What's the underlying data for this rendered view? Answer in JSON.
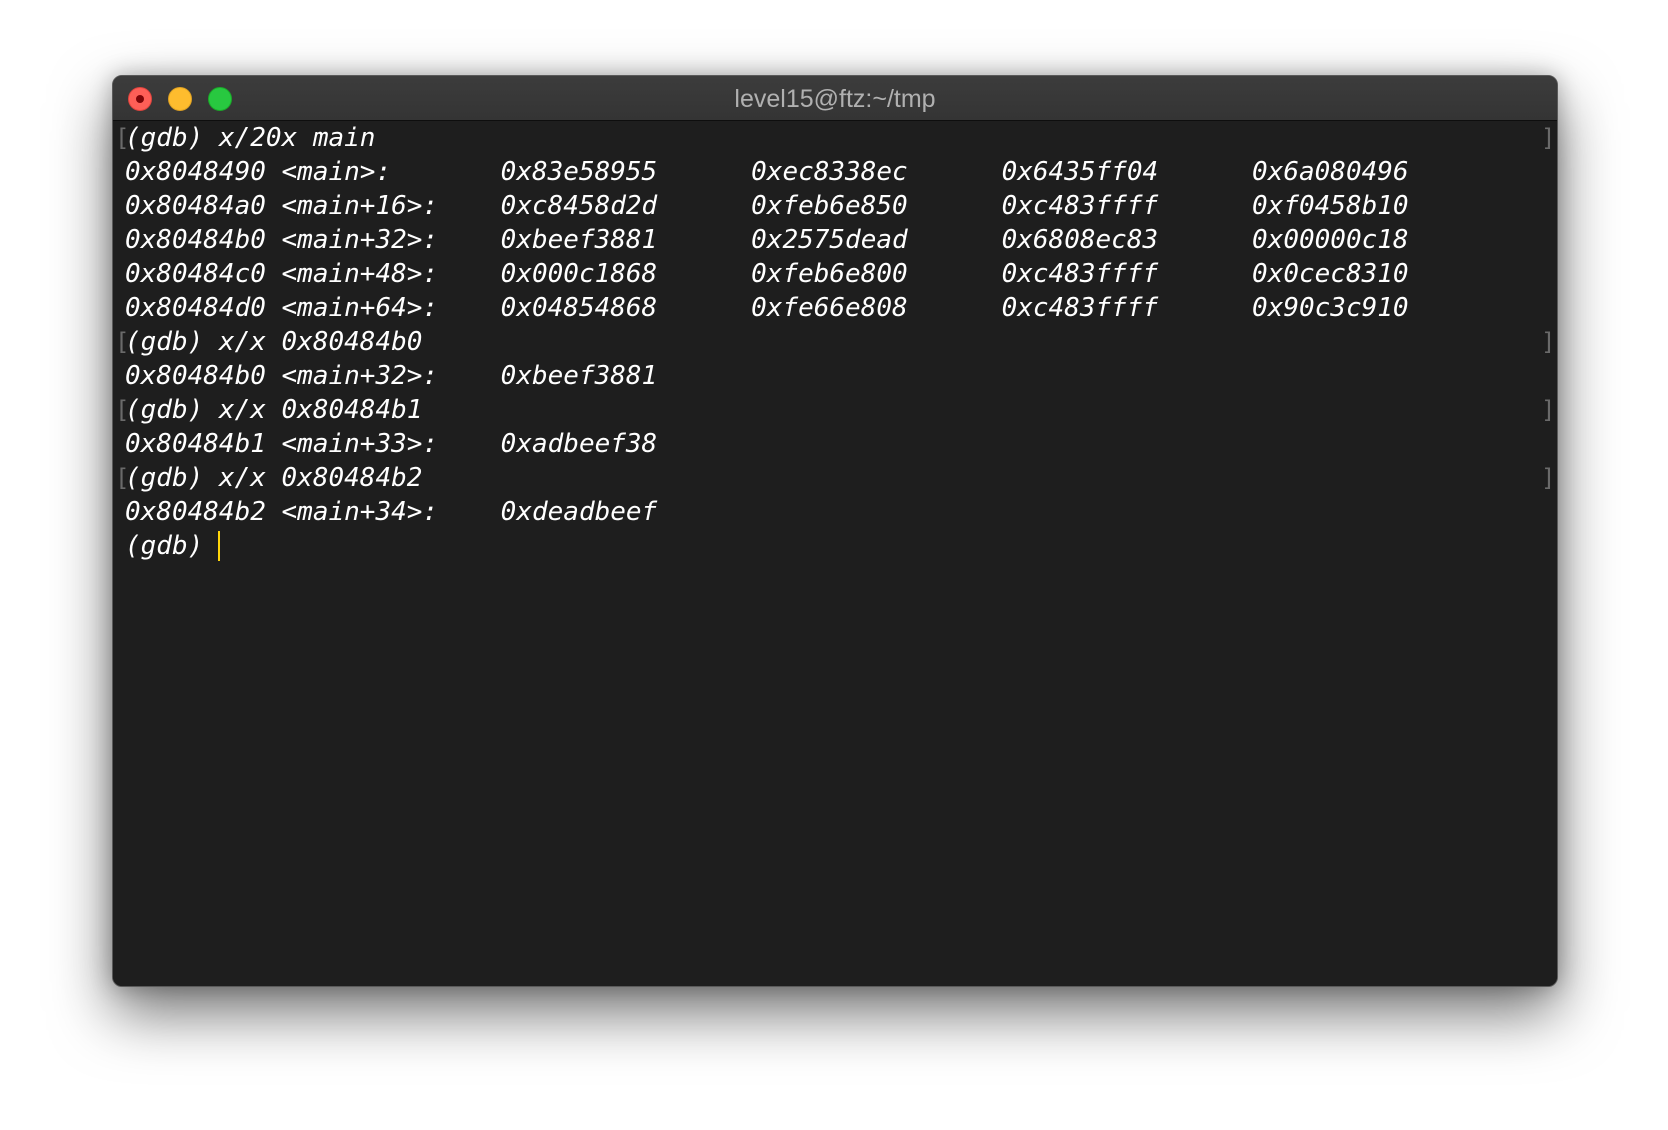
{
  "window": {
    "title": "level15@ftz:~/tmp"
  },
  "terminal": {
    "lines": [
      "(gdb) x/20x main",
      "0x8048490 <main>:       0x83e58955      0xec8338ec      0x6435ff04      0x6a080496",
      "0x80484a0 <main+16>:    0xc8458d2d      0xfeb6e850      0xc483ffff      0xf0458b10",
      "0x80484b0 <main+32>:    0xbeef3881      0x2575dead      0x6808ec83      0x00000c18",
      "0x80484c0 <main+48>:    0x000c1868      0xfeb6e800      0xc483ffff      0x0cec8310",
      "0x80484d0 <main+64>:    0x04854868      0xfe66e808      0xc483ffff      0x90c3c910",
      "(gdb) x/x 0x80484b0",
      "0x80484b0 <main+32>:    0xbeef3881",
      "(gdb) x/x 0x80484b1",
      "0x80484b1 <main+33>:    0xadbeef38",
      "(gdb) x/x 0x80484b2",
      "0x80484b2 <main+34>:    0xdeadbeef",
      "(gdb) "
    ],
    "bracket_left": "[",
    "bracket_right": "]"
  }
}
